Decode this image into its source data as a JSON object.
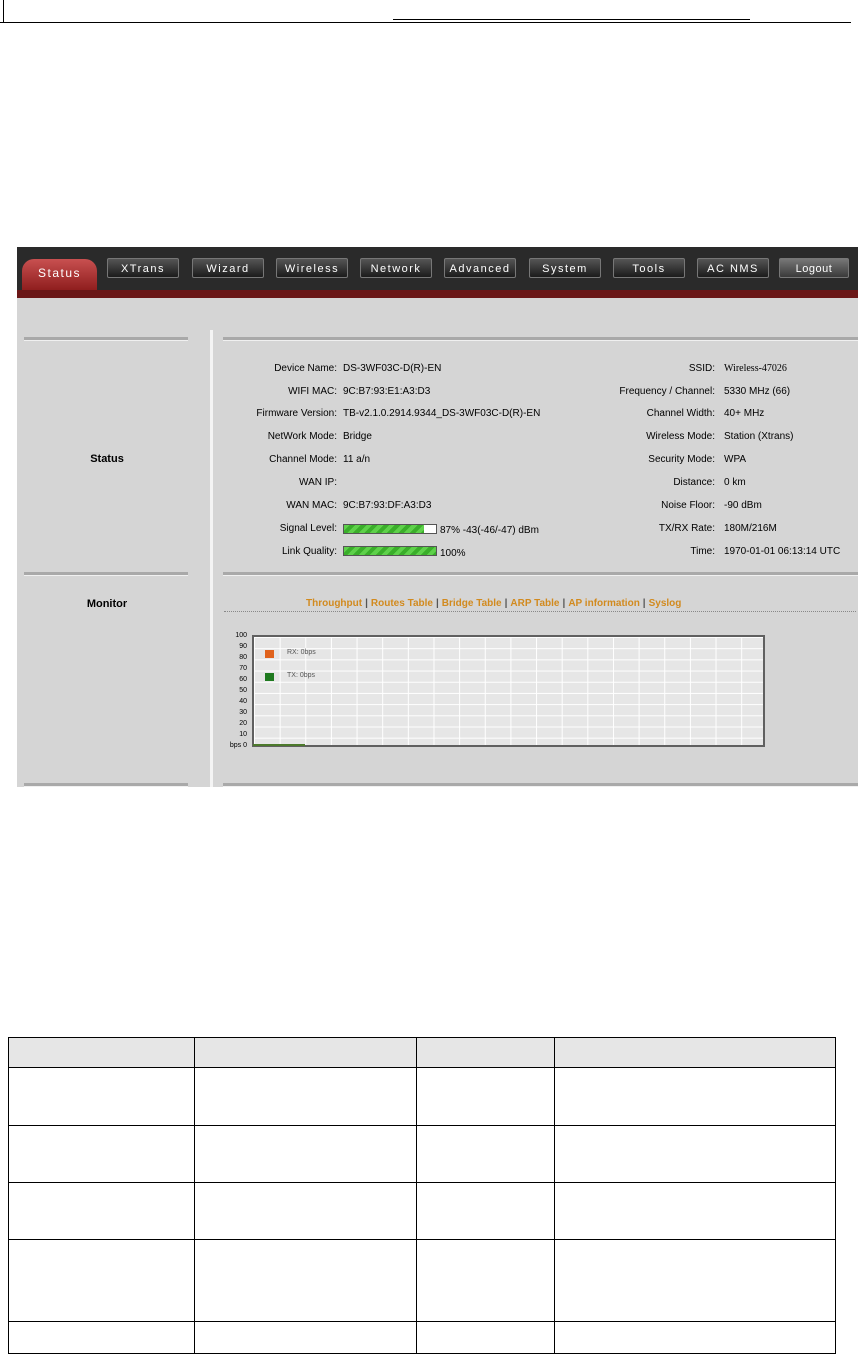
{
  "nav": {
    "tabs": [
      "Status",
      "XTrans",
      "Wizard",
      "Wireless",
      "Network",
      "Advanced",
      "System",
      "Tools",
      "AC NMS"
    ],
    "active": "Status",
    "logout": "Logout"
  },
  "sections": {
    "status": "Status",
    "monitor": "Monitor"
  },
  "status_left": [
    {
      "label": "Device Name:",
      "value": "DS-3WF03C-D(R)-EN"
    },
    {
      "label": "WIFI MAC:",
      "value": "9C:B7:93:E1:A3:D3"
    },
    {
      "label": "Firmware Version:",
      "value": "TB-v2.1.0.2914.9344_DS-3WF03C-D(R)-EN"
    },
    {
      "label": "NetWork Mode:",
      "value": "Bridge"
    },
    {
      "label": "Channel Mode:",
      "value": "11 a/n"
    },
    {
      "label": "WAN IP:",
      "value": ""
    },
    {
      "label": "WAN MAC:",
      "value": "9C:B7:93:DF:A3:D3"
    },
    {
      "label": "Signal Level:",
      "value": "87%  -43(-46/-47) dBm"
    },
    {
      "label": "Link Quality:",
      "value": "100%"
    }
  ],
  "status_right": [
    {
      "label": "SSID:",
      "value": "Wireless-47026"
    },
    {
      "label": "Frequency / Channel:",
      "value": "5330 MHz (66)"
    },
    {
      "label": "Channel Width:",
      "value": "40+ MHz"
    },
    {
      "label": "Wireless Mode:",
      "value": "Station (Xtrans)"
    },
    {
      "label": "Security Mode:",
      "value": "WPA"
    },
    {
      "label": "Distance:",
      "value": "0 km"
    },
    {
      "label": "Noise Floor:",
      "value": "-90 dBm"
    },
    {
      "label": "TX/RX Rate:",
      "value": "180M/216M"
    },
    {
      "label": "Time:",
      "value": "1970-01-01 06:13:14 UTC"
    }
  ],
  "bars": {
    "signal_level": 0.87,
    "link_quality": 1.0
  },
  "monitor_links": [
    "Throughput",
    "Routes Table",
    "Bridge Table",
    "ARP Table",
    "AP information",
    "Syslog"
  ],
  "chart": {
    "y_ticks": [
      "100",
      "90",
      "80",
      "70",
      "60",
      "50",
      "40",
      "30",
      "20",
      "10",
      "bps 0"
    ],
    "legend": [
      {
        "text": "RX: 0bps",
        "color": "#e0621c"
      },
      {
        "text": "TX: 0bps",
        "color": "#1f7a1f"
      }
    ]
  },
  "doc_table_rows": 5
}
